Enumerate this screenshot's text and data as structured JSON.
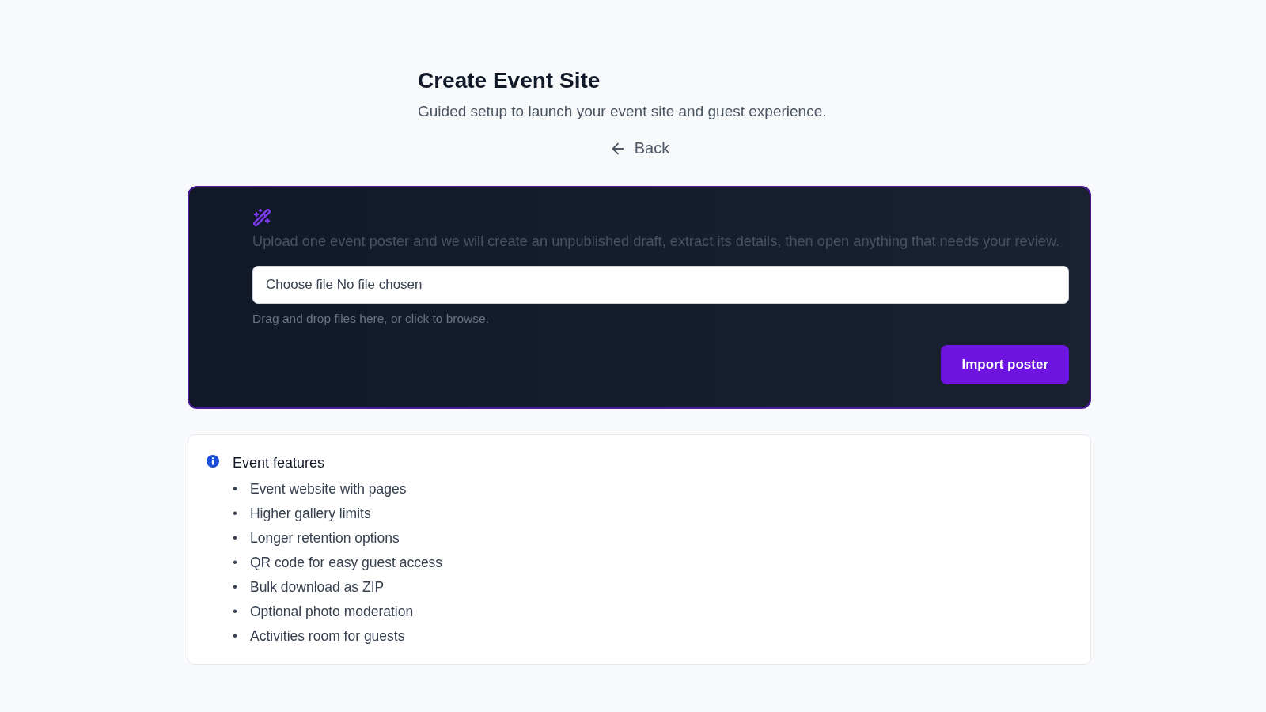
{
  "header": {
    "title": "Create Event Site",
    "subtitle": "Guided setup to launch your event site and guest experience.",
    "back": "Back"
  },
  "import_card": {
    "description": "Upload one event poster and we will create an unpublished draft, extract its details, then open anything that needs your review.",
    "file_input": {
      "value": "Choose file No file chosen"
    },
    "hint": "Drag and drop files here, or click to browse.",
    "button": "Import poster"
  },
  "features": {
    "title": "Event features",
    "bullet": "•",
    "items": [
      "Event website with pages",
      "Higher gallery limits",
      "Longer retention options",
      "QR code for easy guest access",
      "Bulk download as ZIP",
      "Optional photo moderation",
      "Activities room for guests"
    ]
  }
}
